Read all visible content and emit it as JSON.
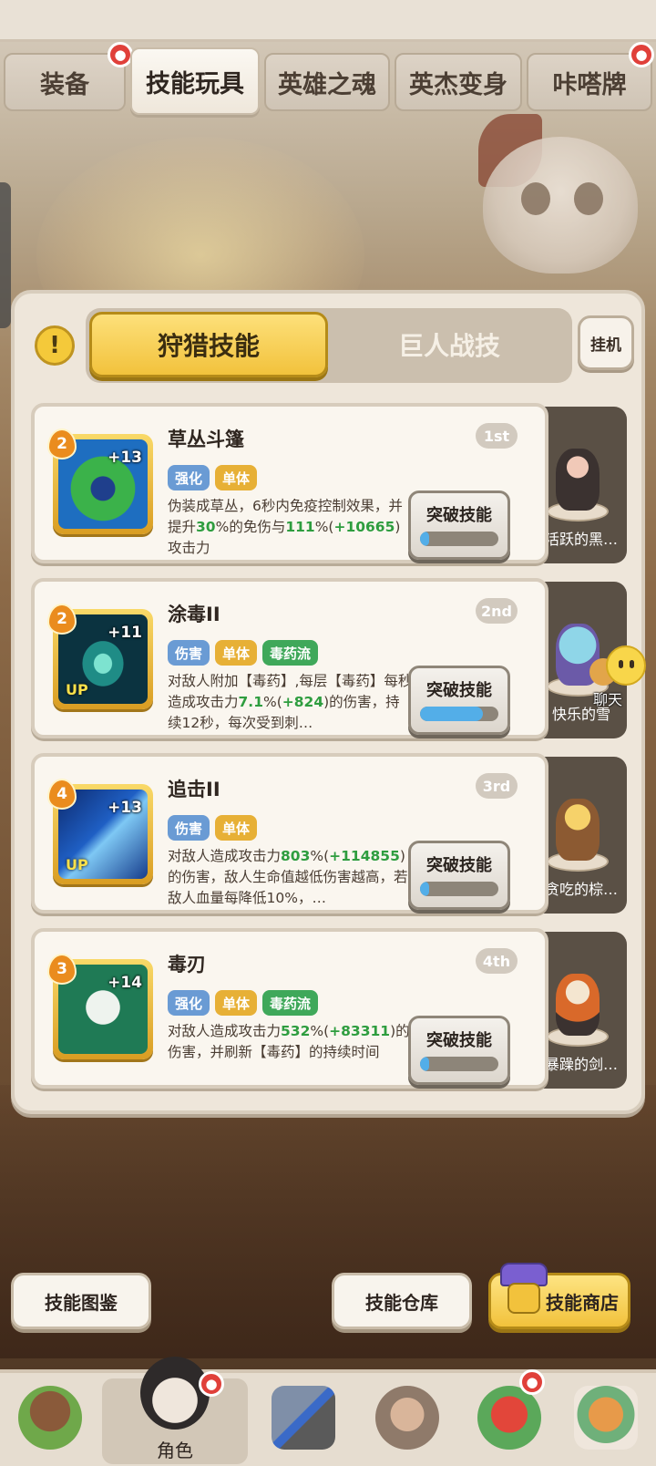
{
  "top_tabs": [
    {
      "label": "装备",
      "badge": true
    },
    {
      "label": "技能玩具",
      "badge": false,
      "active": true
    },
    {
      "label": "英雄之魂",
      "badge": false
    },
    {
      "label": "英杰变身",
      "badge": false
    },
    {
      "label": "咔嗒牌",
      "badge": true
    }
  ],
  "segment": {
    "left_label": "狩猎技能",
    "right_label": "巨人战技",
    "hangup_label": "挂机"
  },
  "skills": [
    {
      "title": "草丛斗篷",
      "rank": "1st",
      "level": "2",
      "plus": "+13",
      "up": "",
      "tags": [
        {
          "text": "强化",
          "color": "blue"
        },
        {
          "text": "单体",
          "color": "orange"
        }
      ],
      "desc_parts": [
        {
          "t": "伪装成草丛，6秒内免疫控制效果，并提升",
          "hl": false
        },
        {
          "t": "30",
          "hl": true
        },
        {
          "t": "%的免伤与",
          "hl": false
        },
        {
          "t": "111",
          "hl": true
        },
        {
          "t": "%(",
          "hl": false
        },
        {
          "t": "+10665",
          "hl": true
        },
        {
          "t": ")攻击力",
          "hl": false
        }
      ],
      "button": "突破技能",
      "progress": 0.12,
      "hero_name": "活跃的黑…"
    },
    {
      "title": "涂毒II",
      "rank": "2nd",
      "level": "2",
      "plus": "+11",
      "up": "UP",
      "tags": [
        {
          "text": "伤害",
          "color": "blue"
        },
        {
          "text": "单体",
          "color": "orange"
        },
        {
          "text": "毒药流",
          "color": "green"
        }
      ],
      "desc_parts": [
        {
          "t": "对敌人附加【毒药】,每层【毒药】每秒造成攻击力",
          "hl": false
        },
        {
          "t": "7.1",
          "hl": true
        },
        {
          "t": "%(",
          "hl": false
        },
        {
          "t": "+824",
          "hl": true
        },
        {
          "t": ")的伤害，持续12秒，每次受到刺…",
          "hl": false
        }
      ],
      "button": "突破技能",
      "progress": 0.8,
      "hero_name": "快乐的雪"
    },
    {
      "title": "追击II",
      "rank": "3rd",
      "level": "4",
      "plus": "+13",
      "up": "UP",
      "tags": [
        {
          "text": "伤害",
          "color": "blue"
        },
        {
          "text": "单体",
          "color": "orange"
        }
      ],
      "desc_parts": [
        {
          "t": "对敌人造成攻击力",
          "hl": false
        },
        {
          "t": "803",
          "hl": true
        },
        {
          "t": "%(",
          "hl": false
        },
        {
          "t": "+114855",
          "hl": true
        },
        {
          "t": ")的伤害，敌人生命值越低伤害越高，若敌人血量每降低10%，…",
          "hl": false
        }
      ],
      "button": "突破技能",
      "progress": 0.12,
      "hero_name": "贪吃的棕…"
    },
    {
      "title": "毒刃",
      "rank": "4th",
      "level": "3",
      "plus": "+14",
      "up": "",
      "tags": [
        {
          "text": "强化",
          "color": "blue"
        },
        {
          "text": "单体",
          "color": "orange"
        },
        {
          "text": "毒药流",
          "color": "green"
        }
      ],
      "desc_parts": [
        {
          "t": "对敌人造成攻击力",
          "hl": false
        },
        {
          "t": "532",
          "hl": true
        },
        {
          "t": "%(",
          "hl": false
        },
        {
          "t": "+83311",
          "hl": true
        },
        {
          "t": ")的伤害，并刷新【毒药】的持续时间",
          "hl": false
        }
      ],
      "button": "突破技能",
      "progress": 0.12,
      "hero_name": "暴躁的剑…"
    }
  ],
  "chat_label": "聊天",
  "actions": {
    "codex": "技能图鉴",
    "warehouse": "技能仓库",
    "shop": "技能商店"
  },
  "nav": [
    {
      "label": "",
      "icon": "bear-house-icon"
    },
    {
      "label": "角色",
      "icon": "hero-icon",
      "badge": true,
      "active": true
    },
    {
      "label": "",
      "icon": "weapon-icon"
    },
    {
      "label": "",
      "icon": "giant-icon"
    },
    {
      "label": "",
      "icon": "pet-dino-icon",
      "badge": true
    },
    {
      "label": "",
      "icon": "totem-icon"
    }
  ],
  "colors": {
    "accent_gold": "#f2c23c",
    "highlight_green": "#2e9d3f",
    "tag_blue": "#6a9bd4",
    "tag_orange": "#e7b036",
    "tag_green": "#3fa85a",
    "badge_red": "#e0403a"
  }
}
